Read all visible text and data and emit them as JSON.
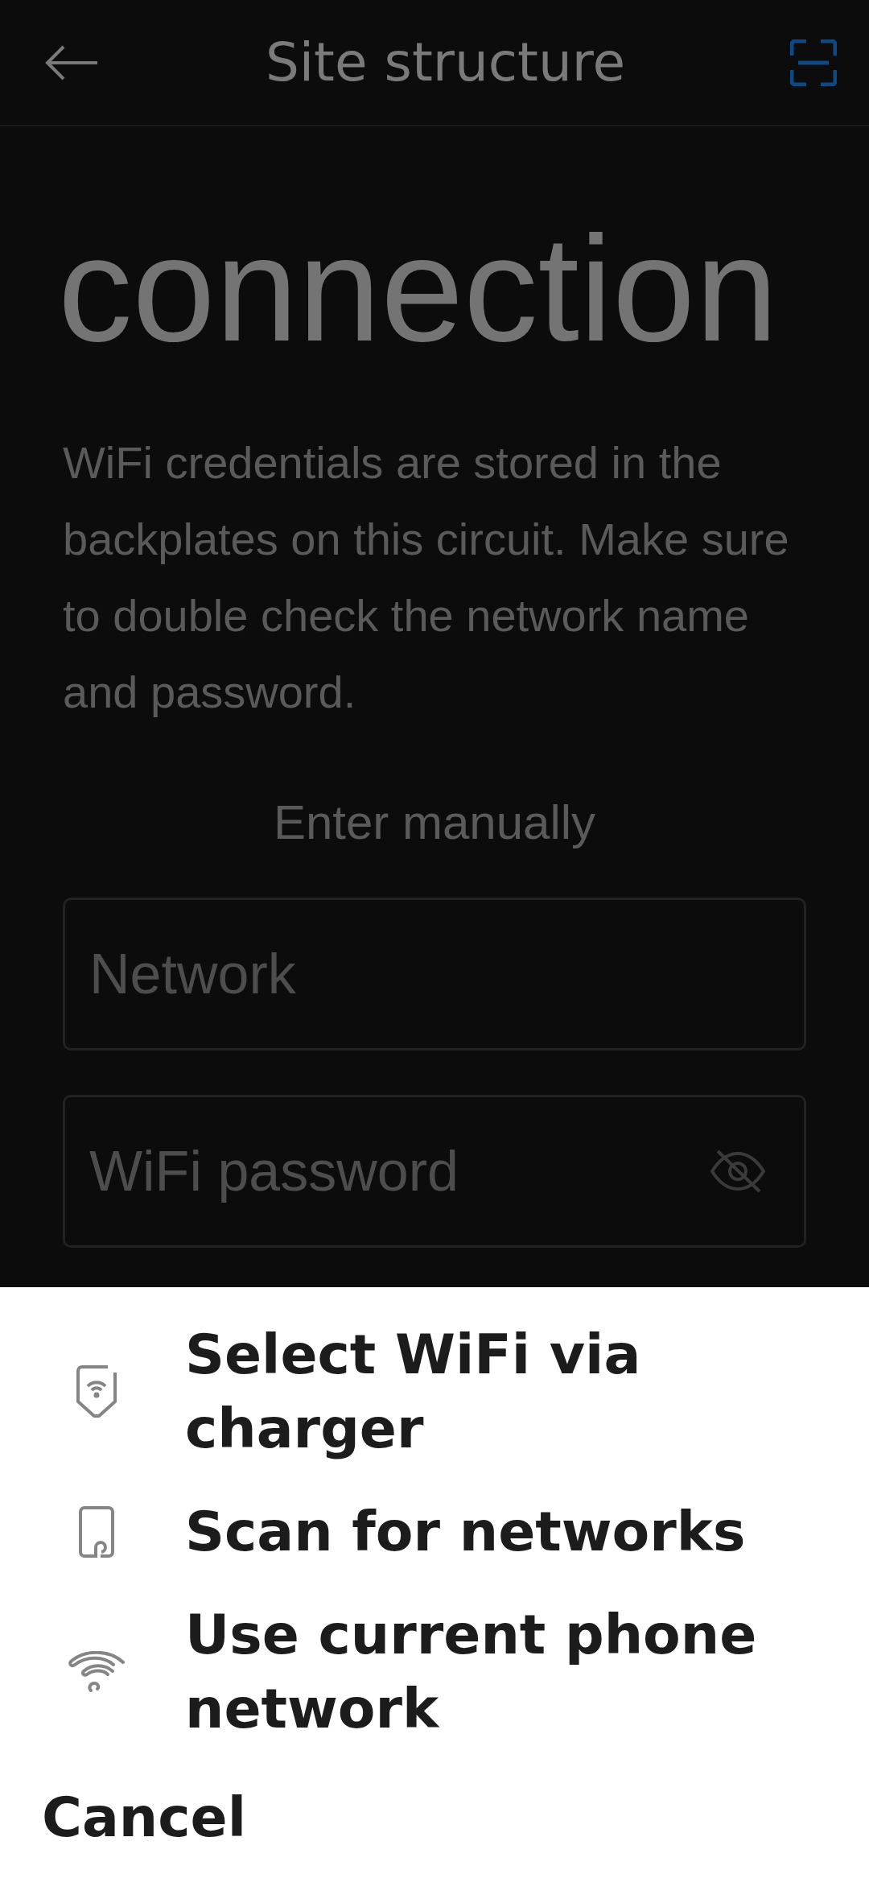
{
  "top_bar": {
    "title": "Site structure"
  },
  "heading": "connection",
  "description": "WiFi credentials are stored in the backplates on this circuit. Make sure to double check the network name and password.",
  "enter_manually": "Enter manually",
  "fields": [
    {
      "placeholder": "Network",
      "kind": "text"
    },
    {
      "placeholder": "WiFi password",
      "kind": "password"
    }
  ],
  "sheet": {
    "options": [
      {
        "label": "Select WiFi via charger",
        "kind": "charger"
      },
      {
        "label": "Scan for networks",
        "kind": "scan"
      },
      {
        "label": "Use current phone network",
        "kind": "phone"
      }
    ],
    "cancel": "Cancel"
  }
}
